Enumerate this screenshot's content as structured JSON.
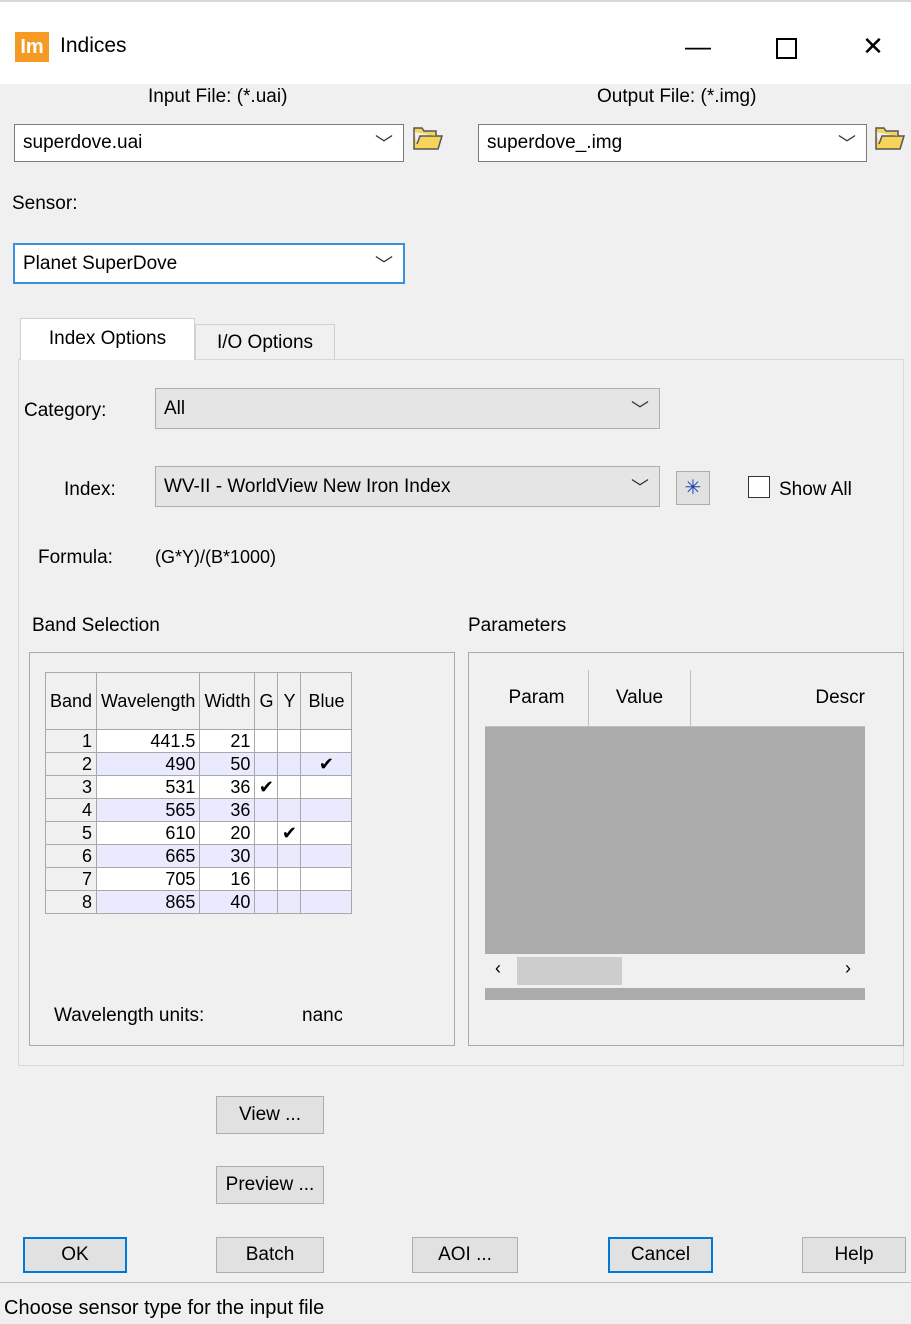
{
  "window": {
    "app_icon_text": "Im",
    "title": "Indices",
    "minimize_glyph": "—",
    "close_glyph": "✕"
  },
  "input_file": {
    "label": "Input File: (*.uai)",
    "value": "superdove.uai"
  },
  "output_file": {
    "label": "Output File: (*.img)",
    "value": "superdove_.img"
  },
  "sensor": {
    "label": "Sensor:",
    "value": "Planet SuperDove"
  },
  "tabs": [
    {
      "label": "Index Options",
      "active": true
    },
    {
      "label": "I/O Options",
      "active": false
    }
  ],
  "category": {
    "label": "Category:",
    "value": "All"
  },
  "index": {
    "label": "Index:",
    "value": "WV-II - WorldView New Iron Index",
    "show_all_label": "Show All",
    "show_all_checked": false
  },
  "formula": {
    "label": "Formula:",
    "value": "(G*Y)/(B*1000)"
  },
  "band_selection": {
    "title": "Band Selection",
    "columns": [
      "Band",
      "Wavelength",
      "Width",
      "G",
      "Y",
      "Blue"
    ],
    "rows": [
      {
        "band": "1",
        "wavelength": "441.5",
        "width": "21",
        "g": "",
        "y": "",
        "blue": ""
      },
      {
        "band": "2",
        "wavelength": "490",
        "width": "50",
        "g": "",
        "y": "",
        "blue": "✔"
      },
      {
        "band": "3",
        "wavelength": "531",
        "width": "36",
        "g": "✔",
        "y": "",
        "blue": ""
      },
      {
        "band": "4",
        "wavelength": "565",
        "width": "36",
        "g": "",
        "y": "",
        "blue": ""
      },
      {
        "band": "5",
        "wavelength": "610",
        "width": "20",
        "g": "",
        "y": "✔",
        "blue": ""
      },
      {
        "band": "6",
        "wavelength": "665",
        "width": "30",
        "g": "",
        "y": "",
        "blue": ""
      },
      {
        "band": "7",
        "wavelength": "705",
        "width": "16",
        "g": "",
        "y": "",
        "blue": ""
      },
      {
        "band": "8",
        "wavelength": "865",
        "width": "40",
        "g": "",
        "y": "",
        "blue": ""
      }
    ],
    "units_label": "Wavelength units:",
    "units_value": "nanc"
  },
  "parameters": {
    "title": "Parameters",
    "columns": [
      "Param",
      "Value",
      "Descr"
    ]
  },
  "buttons": {
    "view": "View ...",
    "preview": "Preview ...",
    "ok": "OK",
    "batch": "Batch",
    "aoi": "AOI ...",
    "cancel": "Cancel",
    "help": "Help"
  },
  "status": "Choose sensor type for the input file",
  "colors": {
    "app_icon": "#f59a23",
    "focus_border": "#3c8fdc",
    "alt_row": "#eaeaff"
  }
}
